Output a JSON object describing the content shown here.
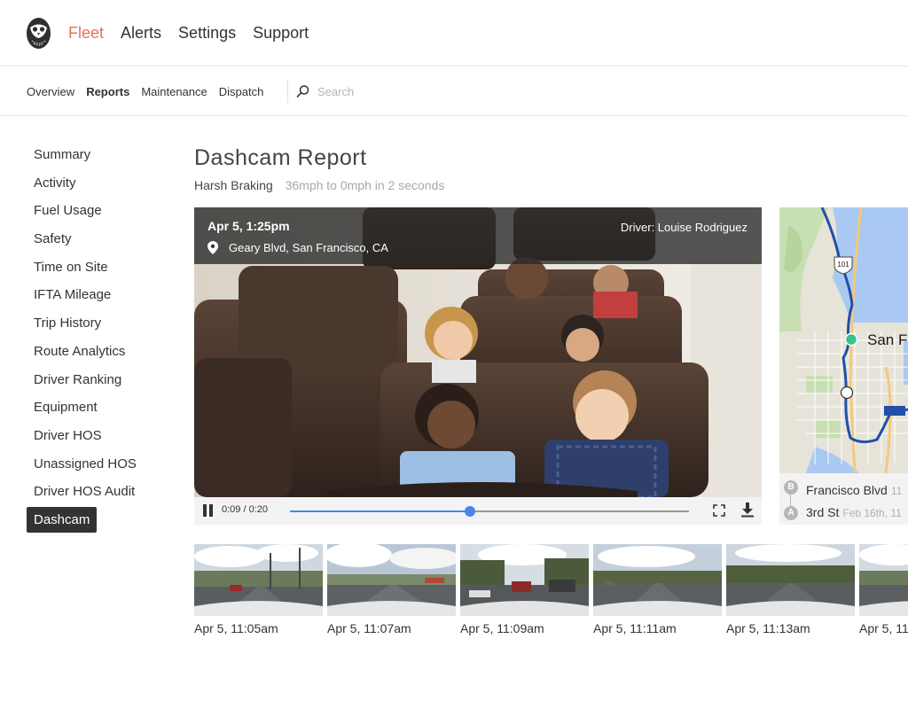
{
  "topnav": {
    "logo_icon": "owl-logo-icon",
    "items": [
      {
        "label": "Fleet",
        "active": true
      },
      {
        "label": "Alerts",
        "active": false
      },
      {
        "label": "Settings",
        "active": false
      },
      {
        "label": "Support",
        "active": false
      }
    ],
    "active_color": "#e8705a"
  },
  "subnav": {
    "items": [
      {
        "label": "Overview",
        "active": false
      },
      {
        "label": "Reports",
        "active": true
      },
      {
        "label": "Maintenance",
        "active": false
      },
      {
        "label": "Dispatch",
        "active": false
      }
    ],
    "search": {
      "icon": "search-icon",
      "placeholder": "Search",
      "value": ""
    }
  },
  "sidebar": {
    "items": [
      {
        "label": "Summary"
      },
      {
        "label": "Activity"
      },
      {
        "label": "Fuel Usage"
      },
      {
        "label": "Safety"
      },
      {
        "label": "Time on Site"
      },
      {
        "label": "IFTA Mileage"
      },
      {
        "label": "Trip History"
      },
      {
        "label": "Route Analytics"
      },
      {
        "label": "Driver Ranking"
      },
      {
        "label": "Equipment"
      },
      {
        "label": "Driver HOS"
      },
      {
        "label": "Unassigned HOS"
      },
      {
        "label": "Driver HOS Audit"
      },
      {
        "label": "Dashcam",
        "active": true
      }
    ]
  },
  "main": {
    "title": "Dashcam Report",
    "event_type": "Harsh Braking",
    "event_detail": "36mph to 0mph in 2 seconds"
  },
  "video": {
    "date": "Apr 5, 1:25pm",
    "location_icon": "map-pin-icon",
    "location": "Geary Blvd, San Francisco, CA",
    "driver": "Driver: Louise Rodriguez",
    "state": "playing",
    "time_display": "0:09 / 0:20",
    "progress": 0.45,
    "accent_color": "#4a86e8"
  },
  "map": {
    "highway_label": "101",
    "city_label": "San F",
    "route_color": "#1f4fa8",
    "current_marker_color": "#3cc08a",
    "route": [
      {
        "badge": "B",
        "street": "Francisco Blvd",
        "date": "11"
      },
      {
        "badge": "A",
        "street": "3rd St",
        "date": "Feb 16th, 11"
      }
    ]
  },
  "thumbnails": [
    {
      "label": "Apr 5, 11:05am"
    },
    {
      "label": "Apr 5, 11:07am"
    },
    {
      "label": "Apr 5, 11:09am"
    },
    {
      "label": "Apr 5, 11:11am"
    },
    {
      "label": "Apr 5, 11:13am"
    },
    {
      "label": "Apr 5, 11"
    }
  ]
}
